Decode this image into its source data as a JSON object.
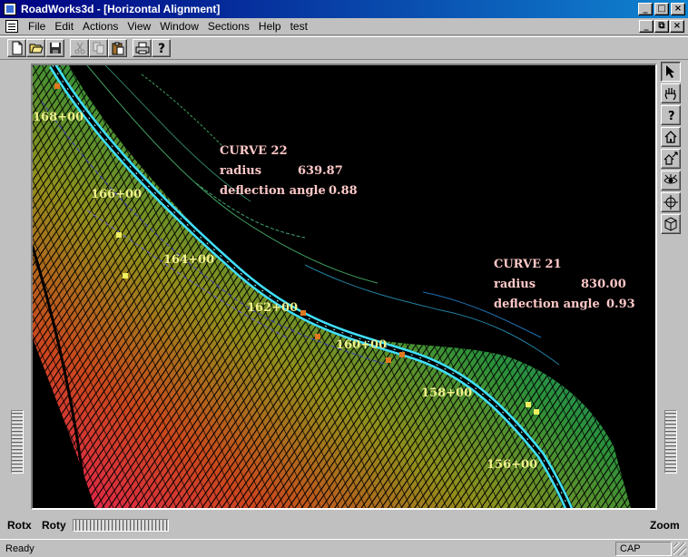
{
  "window": {
    "title": "RoadWorks3d - [Horizontal Alignment]",
    "controls": [
      "_",
      "□",
      "×"
    ],
    "mdi_controls": [
      "_",
      "⧉",
      "×"
    ]
  },
  "menu": {
    "items": [
      "File",
      "Edit",
      "Actions",
      "View",
      "Window",
      "Sections",
      "Help",
      "test"
    ]
  },
  "toolbar": {
    "buttons": [
      "new-icon",
      "open-icon",
      "save-icon",
      "cut-icon",
      "copy-icon",
      "paste-icon",
      "print-icon",
      "help-icon"
    ]
  },
  "view": {
    "stations": [
      "168+00",
      "166+00",
      "164+00",
      "162+00",
      "160+00",
      "158+00",
      "156+00"
    ],
    "curve22": {
      "title": "CURVE  22",
      "radius_label": "radius",
      "radius_value": "639.87",
      "deflection_label": "deflection angle",
      "deflection_value": "0.88"
    },
    "curve21": {
      "title": "CURVE  21",
      "radius_label": "radius",
      "radius_value": "830.00",
      "deflection_label": "deflection angle",
      "deflection_value": "0.93"
    },
    "colors": {
      "background": "#000000",
      "alignment": "#40e0ff",
      "station_text": "#f0f08a",
      "curve_text": "#ffc8c8",
      "marker": "#e07820"
    }
  },
  "right_tools": [
    "pointer-icon",
    "pan-hand-icon",
    "help-query-icon",
    "home-icon",
    "home-zoom-icon",
    "eye-icon",
    "move-cross-icon",
    "cube-icon"
  ],
  "controls": {
    "rotx_label": "Rotx",
    "roty_label": "Roty",
    "zoom_label": "Zoom"
  },
  "status": {
    "text": "Ready",
    "cap": "CAP"
  }
}
